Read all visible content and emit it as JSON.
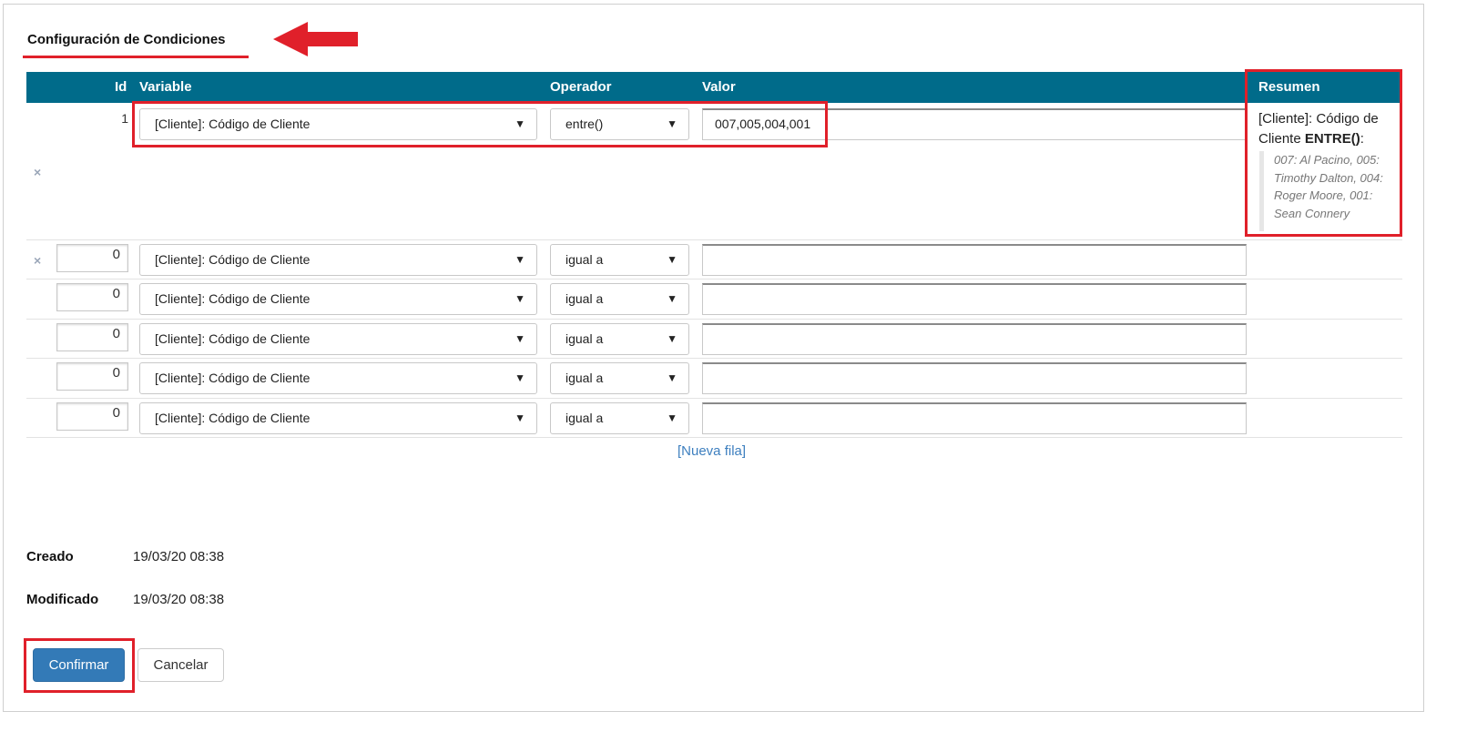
{
  "section": {
    "title": "Configuración de Condiciones"
  },
  "table": {
    "headers": {
      "id": "Id",
      "variable": "Variable",
      "operador": "Operador",
      "valor": "Valor",
      "resumen": "Resumen"
    },
    "rows": [
      {
        "id": "1",
        "variable": "[Cliente]: Código de Cliente",
        "operador": "entre()",
        "valor": "007,005,004,001"
      },
      {
        "id": "0",
        "variable": "[Cliente]: Código de Cliente",
        "operador": "igual a",
        "valor": ""
      },
      {
        "id": "0",
        "variable": "[Cliente]: Código de Cliente",
        "operador": "igual a",
        "valor": ""
      },
      {
        "id": "0",
        "variable": "[Cliente]: Código de Cliente",
        "operador": "igual a",
        "valor": ""
      },
      {
        "id": "0",
        "variable": "[Cliente]: Código de Cliente",
        "operador": "igual a",
        "valor": ""
      },
      {
        "id": "0",
        "variable": "[Cliente]: Código de Cliente",
        "operador": "igual a",
        "valor": ""
      }
    ],
    "delete_glyph": "×",
    "caret_glyph": "▼"
  },
  "resumen": {
    "prefix": "[Cliente]: Código de Cliente ",
    "operator": "ENTRE()",
    "suffix": ":",
    "detail": "007: Al Pacino, 005: Timothy Dalton, 004: Roger Moore, 001: Sean Connery"
  },
  "nueva_fila": "[Nueva fila]",
  "meta": {
    "creado_label": "Creado",
    "creado_value": "19/03/20 08:38",
    "modificado_label": "Modificado",
    "modificado_value": "19/03/20 08:38"
  },
  "buttons": {
    "confirm": "Confirmar",
    "cancel": "Cancelar"
  },
  "colors": {
    "header": "#006b8a",
    "highlight": "#e0202a",
    "primary": "#337ab7",
    "link": "#3d7fbf"
  }
}
